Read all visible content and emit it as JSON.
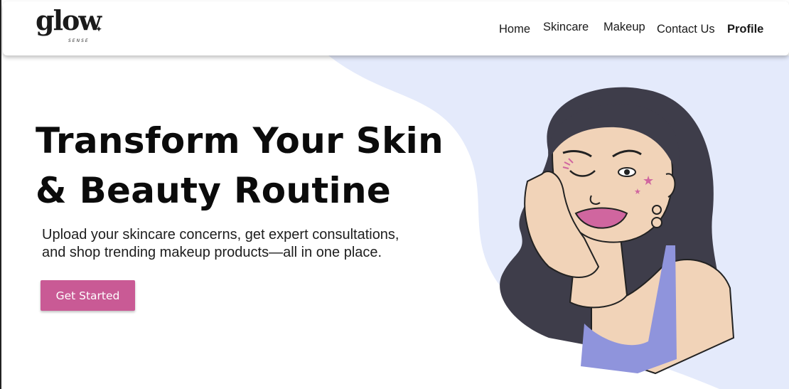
{
  "brand": {
    "logo_word": "glow",
    "logo_sub": "SENSE"
  },
  "nav": {
    "items": [
      {
        "label": "Home"
      },
      {
        "label": "Skincare"
      },
      {
        "label": "Makeup"
      },
      {
        "label": "Contact Us"
      },
      {
        "label": "Profile"
      }
    ]
  },
  "hero": {
    "title_line1": "Transform Your Skin",
    "title_line2": "& Beauty Routine",
    "description_line1": "Upload your skincare concerns, get expert consultations,",
    "description_line2": "and shop trending makeup products—all in one place.",
    "cta_label": "Get Started"
  },
  "colors": {
    "accent": "#c95a95",
    "blob": "#e4eafb",
    "hair": "#3e3d4a",
    "skin": "#f1d3b8",
    "top": "#8f94dc"
  },
  "icons": {
    "logo_star": "sparkle-icon"
  }
}
